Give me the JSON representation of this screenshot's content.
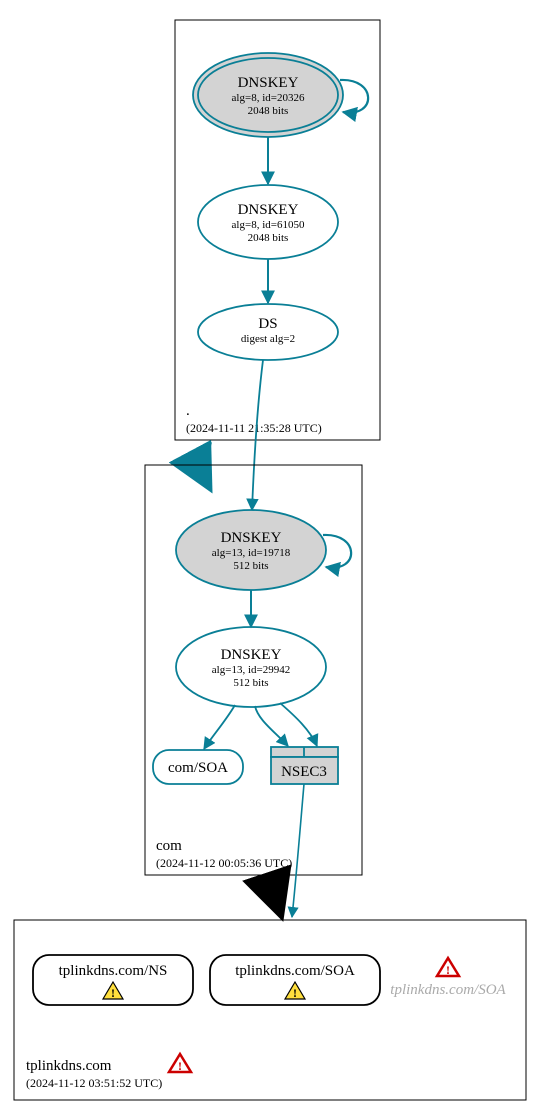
{
  "zones": {
    "root": {
      "name": ".",
      "timestamp": "(2024-11-11 21:35:28 UTC)"
    },
    "com": {
      "name": "com",
      "timestamp": "(2024-11-12 00:05:36 UTC)"
    },
    "leaf": {
      "name": "tplinkdns.com",
      "timestamp": "(2024-11-12 03:51:52 UTC)"
    }
  },
  "nodes": {
    "root_ksk": {
      "title": "DNSKEY",
      "l2": "alg=8, id=20326",
      "l3": "2048 bits"
    },
    "root_zsk": {
      "title": "DNSKEY",
      "l2": "alg=8, id=61050",
      "l3": "2048 bits"
    },
    "root_ds": {
      "title": "DS",
      "l2": "digest alg=2"
    },
    "com_ksk": {
      "title": "DNSKEY",
      "l2": "alg=13, id=19718",
      "l3": "512 bits"
    },
    "com_zsk": {
      "title": "DNSKEY",
      "l2": "alg=13, id=29942",
      "l3": "512 bits"
    },
    "com_soa": {
      "title": "com/SOA"
    },
    "com_nsec3": {
      "title": "NSEC3"
    },
    "leaf_ns": {
      "title": "tplinkdns.com/NS"
    },
    "leaf_soa": {
      "title": "tplinkdns.com/SOA"
    },
    "leaf_soa2": {
      "title": "tplinkdns.com/SOA"
    }
  }
}
